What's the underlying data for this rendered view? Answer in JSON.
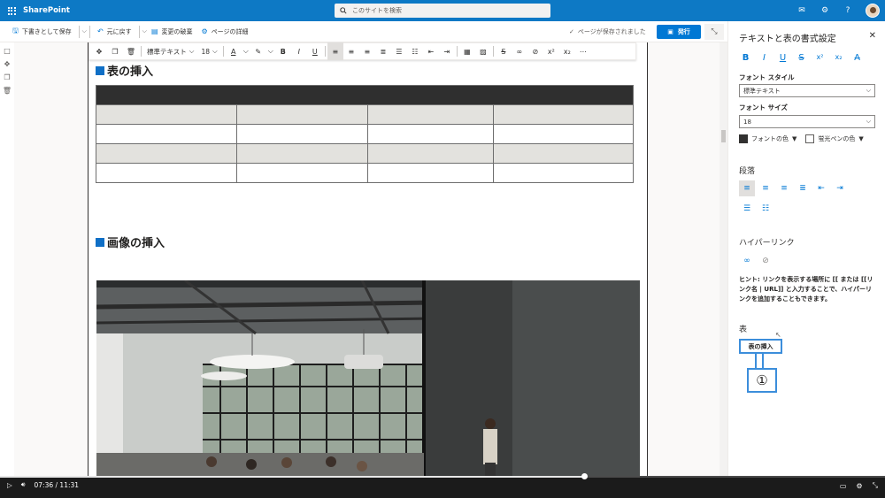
{
  "suite": {
    "brand": "SharePoint",
    "search_placeholder": "このサイトを検索"
  },
  "commands": {
    "save_draft": "下書きとして保存",
    "undo": "元に戻す",
    "discard": "変更の破棄",
    "page_details": "ページの詳細",
    "saved_status": "ページが保存されました",
    "publish": "発行"
  },
  "toolbar": {
    "style_value": "標準テキスト",
    "size_value": "18"
  },
  "document": {
    "heading_table": "表の挿入",
    "heading_image": "画像の挿入"
  },
  "panel": {
    "title": "テキストと表の書式設定",
    "format_buttons": [
      "B",
      "I",
      "U",
      "S",
      "x²",
      "x₂",
      "A̶"
    ],
    "font_style_label": "フォント スタイル",
    "font_style_value": "標準テキスト",
    "font_size_label": "フォント サイズ",
    "font_size_value": "18",
    "font_color_label": "フォントの色",
    "highlight_label": "蛍光ペンの色",
    "paragraph_label": "段落",
    "hyperlink_label": "ハイパーリンク",
    "hint": "ヒント: リンクを表示する場所に [[ または [[リンク名 | URL]] と入力することで、ハイパーリンクを追加することもできます。",
    "table_label": "表",
    "insert_table_button": "表の挿入",
    "callout_number": "①",
    "font_color": "#323130",
    "highlight_color": "#ffffff"
  },
  "video": {
    "time": "07:36 / 11:31",
    "progress": 0.66
  },
  "colors": {
    "suite_blue": "#0d79c5",
    "accent": "#0078d4",
    "heading_square": "#0f6fc6",
    "callout": "#3c8edb"
  }
}
